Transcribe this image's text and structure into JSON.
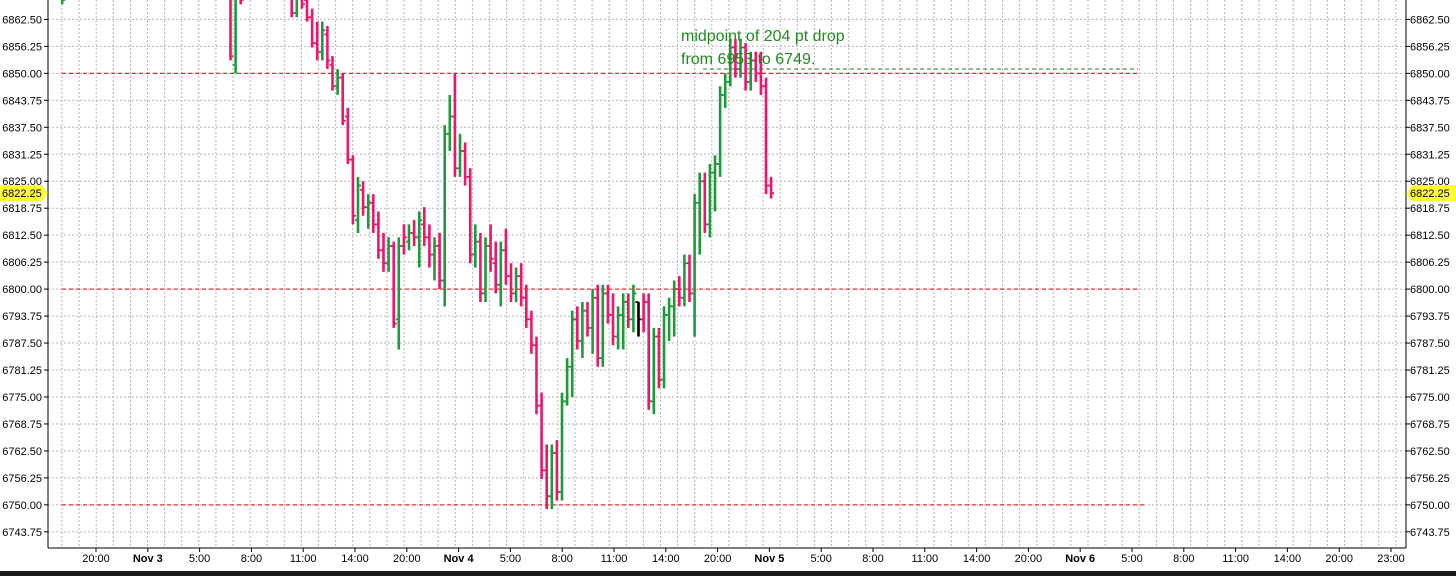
{
  "chart_data": {
    "type": "ohlc",
    "annotation_lines": [
      "midpoint of 204 pt drop",
      "from 6953 to 6749."
    ],
    "current_price": "6822.25",
    "ylim": [
      6740.0,
      6867.0
    ],
    "y_ticks": [
      "6862.50",
      "6856.25",
      "6850.00",
      "6843.75",
      "6837.50",
      "6831.25",
      "6825.00",
      "6818.75",
      "6812.50",
      "6806.25",
      "6800.00",
      "6793.75",
      "6787.50",
      "6781.25",
      "6775.00",
      "6768.75",
      "6762.50",
      "6756.25",
      "6750.00",
      "6743.75"
    ],
    "x_ticks": [
      {
        "label": "20:00",
        "day": false
      },
      {
        "label": "Nov 3",
        "day": true
      },
      {
        "label": "5:00",
        "day": false
      },
      {
        "label": "8:00",
        "day": false
      },
      {
        "label": "11:00",
        "day": false
      },
      {
        "label": "14:00",
        "day": false
      },
      {
        "label": "20:00",
        "day": false
      },
      {
        "label": "Nov 4",
        "day": true
      },
      {
        "label": "5:00",
        "day": false
      },
      {
        "label": "8:00",
        "day": false
      },
      {
        "label": "11:00",
        "day": false
      },
      {
        "label": "14:00",
        "day": false
      },
      {
        "label": "20:00",
        "day": false
      },
      {
        "label": "Nov 5",
        "day": true
      },
      {
        "label": "5:00",
        "day": false
      },
      {
        "label": "8:00",
        "day": false
      },
      {
        "label": "11:00",
        "day": false
      },
      {
        "label": "14:00",
        "day": false
      },
      {
        "label": "20:00",
        "day": false
      },
      {
        "label": "Nov 6",
        "day": true
      },
      {
        "label": "5:00",
        "day": false
      },
      {
        "label": "8:00",
        "day": false
      },
      {
        "label": "11:00",
        "day": false
      },
      {
        "label": "14:00",
        "day": false
      },
      {
        "label": "20:00",
        "day": false
      },
      {
        "label": "23:00",
        "day": false
      }
    ],
    "reference_lines": [
      {
        "value": 6850.0,
        "color": "#e53030",
        "style": "dashed"
      },
      {
        "value": 6800.0,
        "color": "#e53030",
        "style": "dashed"
      },
      {
        "value": 6750.0,
        "color": "#e53030",
        "style": "dashed"
      },
      {
        "value": 6851.0,
        "color": "#1f8a1f",
        "style": "dashed"
      }
    ],
    "colors": {
      "up": "#1f9a3a",
      "down": "#f0156a",
      "neutral": "#000000",
      "grid": "#b5b5b5",
      "highlight": "#ffff33"
    },
    "bars": [
      {
        "i": 2,
        "o": 6870,
        "h": 6870,
        "l": 6866,
        "c": 6867,
        "dir": "up"
      },
      {
        "i": 35,
        "o": 6870,
        "h": 6870,
        "l": 6853,
        "c": 6854,
        "dir": "down"
      },
      {
        "i": 36,
        "o": 6852,
        "h": 6870,
        "l": 6850,
        "c": 6869,
        "dir": "up"
      },
      {
        "i": 37,
        "o": 6868,
        "h": 6870,
        "l": 6866,
        "c": 6867,
        "dir": "down"
      },
      {
        "i": 47,
        "o": 6870,
        "h": 6870,
        "l": 6863,
        "c": 6864,
        "dir": "down"
      },
      {
        "i": 48,
        "o": 6864,
        "h": 6870,
        "l": 6863,
        "c": 6868,
        "dir": "up"
      },
      {
        "i": 49,
        "o": 6868,
        "h": 6870,
        "l": 6865,
        "c": 6866,
        "dir": "down"
      },
      {
        "i": 50,
        "o": 6867,
        "h": 6868,
        "l": 6862,
        "c": 6863,
        "dir": "down"
      },
      {
        "i": 51,
        "o": 6863,
        "h": 6865,
        "l": 6856,
        "c": 6857,
        "dir": "down"
      },
      {
        "i": 52,
        "o": 6857,
        "h": 6862,
        "l": 6853,
        "c": 6855,
        "dir": "down"
      },
      {
        "i": 53,
        "o": 6855,
        "h": 6862,
        "l": 6853,
        "c": 6860,
        "dir": "up"
      },
      {
        "i": 54,
        "o": 6859,
        "h": 6861,
        "l": 6851,
        "c": 6853,
        "dir": "down"
      },
      {
        "i": 55,
        "o": 6852,
        "h": 6854,
        "l": 6846,
        "c": 6847,
        "dir": "down"
      },
      {
        "i": 56,
        "o": 6847,
        "h": 6851,
        "l": 6845,
        "c": 6849,
        "dir": "up"
      },
      {
        "i": 57,
        "o": 6849,
        "h": 6850,
        "l": 6838,
        "c": 6839,
        "dir": "down"
      },
      {
        "i": 58,
        "o": 6840,
        "h": 6842,
        "l": 6829,
        "c": 6830,
        "dir": "down"
      },
      {
        "i": 59,
        "o": 6830,
        "h": 6831,
        "l": 6815,
        "c": 6817,
        "dir": "down"
      },
      {
        "i": 60,
        "o": 6816,
        "h": 6826,
        "l": 6813,
        "c": 6824,
        "dir": "up"
      },
      {
        "i": 61,
        "o": 6823,
        "h": 6825,
        "l": 6817,
        "c": 6819,
        "dir": "down"
      },
      {
        "i": 62,
        "o": 6819,
        "h": 6822,
        "l": 6814,
        "c": 6820,
        "dir": "up"
      },
      {
        "i": 63,
        "o": 6820,
        "h": 6822,
        "l": 6813,
        "c": 6815,
        "dir": "down"
      },
      {
        "i": 64,
        "o": 6815,
        "h": 6818,
        "l": 6807,
        "c": 6809,
        "dir": "down"
      },
      {
        "i": 65,
        "o": 6809,
        "h": 6813,
        "l": 6804,
        "c": 6806,
        "dir": "down"
      },
      {
        "i": 66,
        "o": 6806,
        "h": 6812,
        "l": 6804,
        "c": 6810,
        "dir": "up"
      },
      {
        "i": 67,
        "o": 6810,
        "h": 6811,
        "l": 6791,
        "c": 6792,
        "dir": "down"
      },
      {
        "i": 68,
        "o": 6793,
        "h": 6812,
        "l": 6786,
        "c": 6810,
        "dir": "up"
      },
      {
        "i": 69,
        "o": 6810,
        "h": 6815,
        "l": 6808,
        "c": 6812,
        "dir": "down"
      },
      {
        "i": 70,
        "o": 6811,
        "h": 6815,
        "l": 6809,
        "c": 6813,
        "dir": "up"
      },
      {
        "i": 71,
        "o": 6813,
        "h": 6816,
        "l": 6810,
        "c": 6812,
        "dir": "down"
      },
      {
        "i": 72,
        "o": 6812,
        "h": 6818,
        "l": 6805,
        "c": 6816,
        "dir": "up"
      },
      {
        "i": 73,
        "o": 6815,
        "h": 6819,
        "l": 6810,
        "c": 6812,
        "dir": "down"
      },
      {
        "i": 74,
        "o": 6812,
        "h": 6815,
        "l": 6805,
        "c": 6808,
        "dir": "down"
      },
      {
        "i": 75,
        "o": 6808,
        "h": 6812,
        "l": 6802,
        "c": 6810,
        "dir": "up"
      },
      {
        "i": 76,
        "o": 6810,
        "h": 6813,
        "l": 6800,
        "c": 6802,
        "dir": "down"
      },
      {
        "i": 77,
        "o": 6802,
        "h": 6838,
        "l": 6796,
        "c": 6836,
        "dir": "up"
      },
      {
        "i": 78,
        "o": 6836,
        "h": 6845,
        "l": 6832,
        "c": 6840,
        "dir": "up"
      },
      {
        "i": 79,
        "o": 6840,
        "h": 6850,
        "l": 6826,
        "c": 6828,
        "dir": "down"
      },
      {
        "i": 80,
        "o": 6828,
        "h": 6836,
        "l": 6826,
        "c": 6832,
        "dir": "up"
      },
      {
        "i": 81,
        "o": 6832,
        "h": 6834,
        "l": 6824,
        "c": 6826,
        "dir": "down"
      },
      {
        "i": 82,
        "o": 6826,
        "h": 6828,
        "l": 6806,
        "c": 6808,
        "dir": "down"
      },
      {
        "i": 83,
        "o": 6808,
        "h": 6815,
        "l": 6805,
        "c": 6811,
        "dir": "up"
      },
      {
        "i": 84,
        "o": 6811,
        "h": 6813,
        "l": 6797,
        "c": 6799,
        "dir": "down"
      },
      {
        "i": 85,
        "o": 6799,
        "h": 6812,
        "l": 6797,
        "c": 6810,
        "dir": "up"
      },
      {
        "i": 86,
        "o": 6810,
        "h": 6815,
        "l": 6804,
        "c": 6807,
        "dir": "down"
      },
      {
        "i": 87,
        "o": 6806,
        "h": 6811,
        "l": 6799,
        "c": 6801,
        "dir": "down"
      },
      {
        "i": 88,
        "o": 6801,
        "h": 6811,
        "l": 6796,
        "c": 6809,
        "dir": "up"
      },
      {
        "i": 89,
        "o": 6809,
        "h": 6814,
        "l": 6801,
        "c": 6803,
        "dir": "down"
      },
      {
        "i": 90,
        "o": 6803,
        "h": 6806,
        "l": 6797,
        "c": 6799,
        "dir": "down"
      },
      {
        "i": 91,
        "o": 6799,
        "h": 6805,
        "l": 6797,
        "c": 6803,
        "dir": "up"
      },
      {
        "i": 92,
        "o": 6803,
        "h": 6806,
        "l": 6796,
        "c": 6798,
        "dir": "down"
      },
      {
        "i": 93,
        "o": 6798,
        "h": 6801,
        "l": 6791,
        "c": 6793,
        "dir": "down"
      },
      {
        "i": 94,
        "o": 6793,
        "h": 6795,
        "l": 6785,
        "c": 6787,
        "dir": "down"
      },
      {
        "i": 95,
        "o": 6787,
        "h": 6789,
        "l": 6771,
        "c": 6773,
        "dir": "down"
      },
      {
        "i": 96,
        "o": 6773,
        "h": 6776,
        "l": 6756,
        "c": 6758,
        "dir": "down"
      },
      {
        "i": 97,
        "o": 6758,
        "h": 6764,
        "l": 6749,
        "c": 6752,
        "dir": "down"
      },
      {
        "i": 98,
        "o": 6752,
        "h": 6764,
        "l": 6749,
        "c": 6762,
        "dir": "up"
      },
      {
        "i": 99,
        "o": 6762,
        "h": 6765,
        "l": 6751,
        "c": 6753,
        "dir": "down"
      },
      {
        "i": 100,
        "o": 6753,
        "h": 6776,
        "l": 6751,
        "c": 6774,
        "dir": "up"
      },
      {
        "i": 101,
        "o": 6774,
        "h": 6784,
        "l": 6773,
        "c": 6782,
        "dir": "up"
      },
      {
        "i": 102,
        "o": 6782,
        "h": 6795,
        "l": 6775,
        "c": 6793,
        "dir": "up"
      },
      {
        "i": 103,
        "o": 6793,
        "h": 6796,
        "l": 6786,
        "c": 6788,
        "dir": "down"
      },
      {
        "i": 104,
        "o": 6788,
        "h": 6797,
        "l": 6784,
        "c": 6795,
        "dir": "up"
      },
      {
        "i": 105,
        "o": 6795,
        "h": 6797,
        "l": 6789,
        "c": 6791,
        "dir": "down"
      },
      {
        "i": 106,
        "o": 6791,
        "h": 6800,
        "l": 6785,
        "c": 6798,
        "dir": "up"
      },
      {
        "i": 107,
        "o": 6798,
        "h": 6801,
        "l": 6782,
        "c": 6784,
        "dir": "down"
      },
      {
        "i": 108,
        "o": 6784,
        "h": 6801,
        "l": 6782,
        "c": 6799,
        "dir": "up"
      },
      {
        "i": 109,
        "o": 6799,
        "h": 6801,
        "l": 6792,
        "c": 6794,
        "dir": "down"
      },
      {
        "i": 110,
        "o": 6794,
        "h": 6799,
        "l": 6787,
        "c": 6789,
        "dir": "down"
      },
      {
        "i": 111,
        "o": 6789,
        "h": 6796,
        "l": 6786,
        "c": 6794,
        "dir": "up"
      },
      {
        "i": 112,
        "o": 6794,
        "h": 6799,
        "l": 6786,
        "c": 6797,
        "dir": "up"
      },
      {
        "i": 113,
        "o": 6797,
        "h": 6799,
        "l": 6791,
        "c": 6793,
        "dir": "down"
      },
      {
        "i": 114,
        "o": 6793,
        "h": 6801,
        "l": 6790,
        "c": 6799,
        "dir": "up"
      },
      {
        "i": 115,
        "o": 6797,
        "h": 6797,
        "l": 6789,
        "c": 6793,
        "dir": "neutral"
      },
      {
        "i": 116,
        "o": 6793,
        "h": 6799,
        "l": 6790,
        "c": 6797,
        "dir": "down"
      },
      {
        "i": 117,
        "o": 6797,
        "h": 6799,
        "l": 6772,
        "c": 6774,
        "dir": "down"
      },
      {
        "i": 118,
        "o": 6774,
        "h": 6791,
        "l": 6771,
        "c": 6789,
        "dir": "up"
      },
      {
        "i": 119,
        "o": 6789,
        "h": 6791,
        "l": 6777,
        "c": 6779,
        "dir": "down"
      },
      {
        "i": 120,
        "o": 6779,
        "h": 6796,
        "l": 6777,
        "c": 6794,
        "dir": "up"
      },
      {
        "i": 121,
        "o": 6794,
        "h": 6798,
        "l": 6788,
        "c": 6796,
        "dir": "up"
      },
      {
        "i": 122,
        "o": 6796,
        "h": 6802,
        "l": 6789,
        "c": 6800,
        "dir": "up"
      },
      {
        "i": 123,
        "o": 6800,
        "h": 6803,
        "l": 6796,
        "c": 6798,
        "dir": "down"
      },
      {
        "i": 124,
        "o": 6798,
        "h": 6808,
        "l": 6796,
        "c": 6806,
        "dir": "up"
      },
      {
        "i": 125,
        "o": 6806,
        "h": 6808,
        "l": 6797,
        "c": 6799,
        "dir": "down"
      },
      {
        "i": 126,
        "o": 6799,
        "h": 6822,
        "l": 6789,
        "c": 6820,
        "dir": "up"
      },
      {
        "i": 127,
        "o": 6820,
        "h": 6827,
        "l": 6808,
        "c": 6825,
        "dir": "up"
      },
      {
        "i": 128,
        "o": 6825,
        "h": 6827,
        "l": 6813,
        "c": 6815,
        "dir": "down"
      },
      {
        "i": 129,
        "o": 6815,
        "h": 6829,
        "l": 6812,
        "c": 6827,
        "dir": "up"
      },
      {
        "i": 130,
        "o": 6827,
        "h": 6831,
        "l": 6818,
        "c": 6829,
        "dir": "up"
      },
      {
        "i": 131,
        "o": 6829,
        "h": 6847,
        "l": 6826,
        "c": 6845,
        "dir": "up"
      },
      {
        "i": 132,
        "o": 6845,
        "h": 6850,
        "l": 6842,
        "c": 6848,
        "dir": "up"
      },
      {
        "i": 133,
        "o": 6848,
        "h": 6858,
        "l": 6847,
        "c": 6856,
        "dir": "up"
      },
      {
        "i": 134,
        "o": 6856,
        "h": 6858,
        "l": 6849,
        "c": 6851,
        "dir": "down"
      },
      {
        "i": 135,
        "o": 6851,
        "h": 6858,
        "l": 6849,
        "c": 6856,
        "dir": "up"
      },
      {
        "i": 136,
        "o": 6856,
        "h": 6857,
        "l": 6846,
        "c": 6848,
        "dir": "down"
      },
      {
        "i": 137,
        "o": 6848,
        "h": 6855,
        "l": 6846,
        "c": 6853,
        "dir": "up"
      },
      {
        "i": 138,
        "o": 6853,
        "h": 6855,
        "l": 6848,
        "c": 6850,
        "dir": "down"
      },
      {
        "i": 139,
        "o": 6850,
        "h": 6855,
        "l": 6845,
        "c": 6847,
        "dir": "down"
      },
      {
        "i": 140,
        "o": 6847,
        "h": 6849,
        "l": 6822,
        "c": 6824,
        "dir": "down"
      },
      {
        "i": 141,
        "o": 6824,
        "h": 6826,
        "l": 6821,
        "c": 6822.25,
        "dir": "down"
      }
    ]
  }
}
